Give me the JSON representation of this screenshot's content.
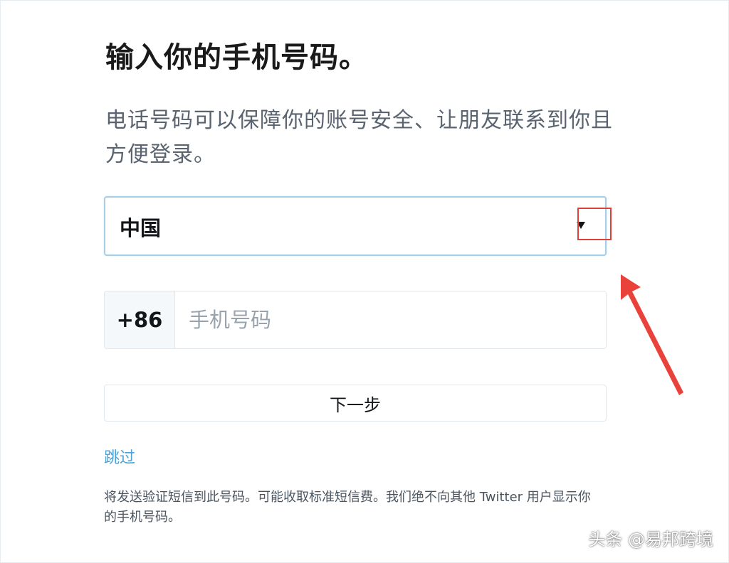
{
  "page": {
    "title": "输入你的手机号码。",
    "subtitle": "电话号码可以保障你的账号安全、让朋友联系到你且方便登录。"
  },
  "country_select": {
    "value": "中国",
    "icon": "dropdown-triangle-icon"
  },
  "phone": {
    "country_code": "+86",
    "value": "",
    "placeholder": "手机号码"
  },
  "actions": {
    "next_label": "下一步",
    "skip_label": "跳过"
  },
  "footer": {
    "note": "将发送验证短信到此号码。可能收取标准短信费。我们绝不向其他 Twitter 用户显示你的手机号码。"
  },
  "annotations": {
    "highlight_color": "#e0403a",
    "arrow_color": "#e8423a"
  },
  "watermark": {
    "text": "头条 @易邦跨境"
  },
  "colors": {
    "link": "#4ba3d9",
    "focus_border": "#a8cde6",
    "border": "#e1e8ed",
    "code_bg": "#f5f8fa"
  }
}
